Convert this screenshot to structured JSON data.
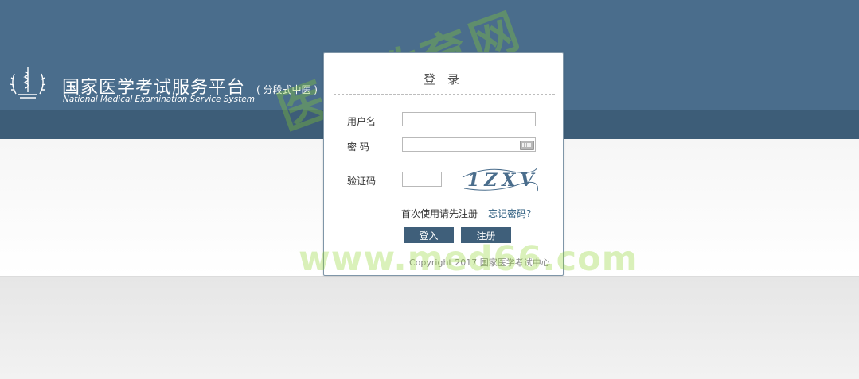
{
  "header": {
    "title": "国家医学考试服务平台",
    "subtitle": "( 分段式中医 )",
    "english_title": "National Medical Examination Service System",
    "logo_icon": "medical-emblem-icon"
  },
  "login": {
    "title": "登 录",
    "username_label": "用户名",
    "password_label": "密 码",
    "captcha_label": "验证码",
    "captcha_text": "1ZXV",
    "first_use_text": "首次使用请先注册",
    "forgot_password": "忘记密码?",
    "login_button": "登入",
    "register_button": "注册",
    "copyright": "Copyright 2017 国家医学考试中心"
  },
  "watermark": {
    "chinese": "医学教育网",
    "url": "www.med66.com"
  },
  "colors": {
    "header": "#4a6d8c",
    "header_strip": "#3d5d78",
    "button": "#3f5f7a",
    "link": "#2d5d7f",
    "watermark": "#8cd228"
  }
}
